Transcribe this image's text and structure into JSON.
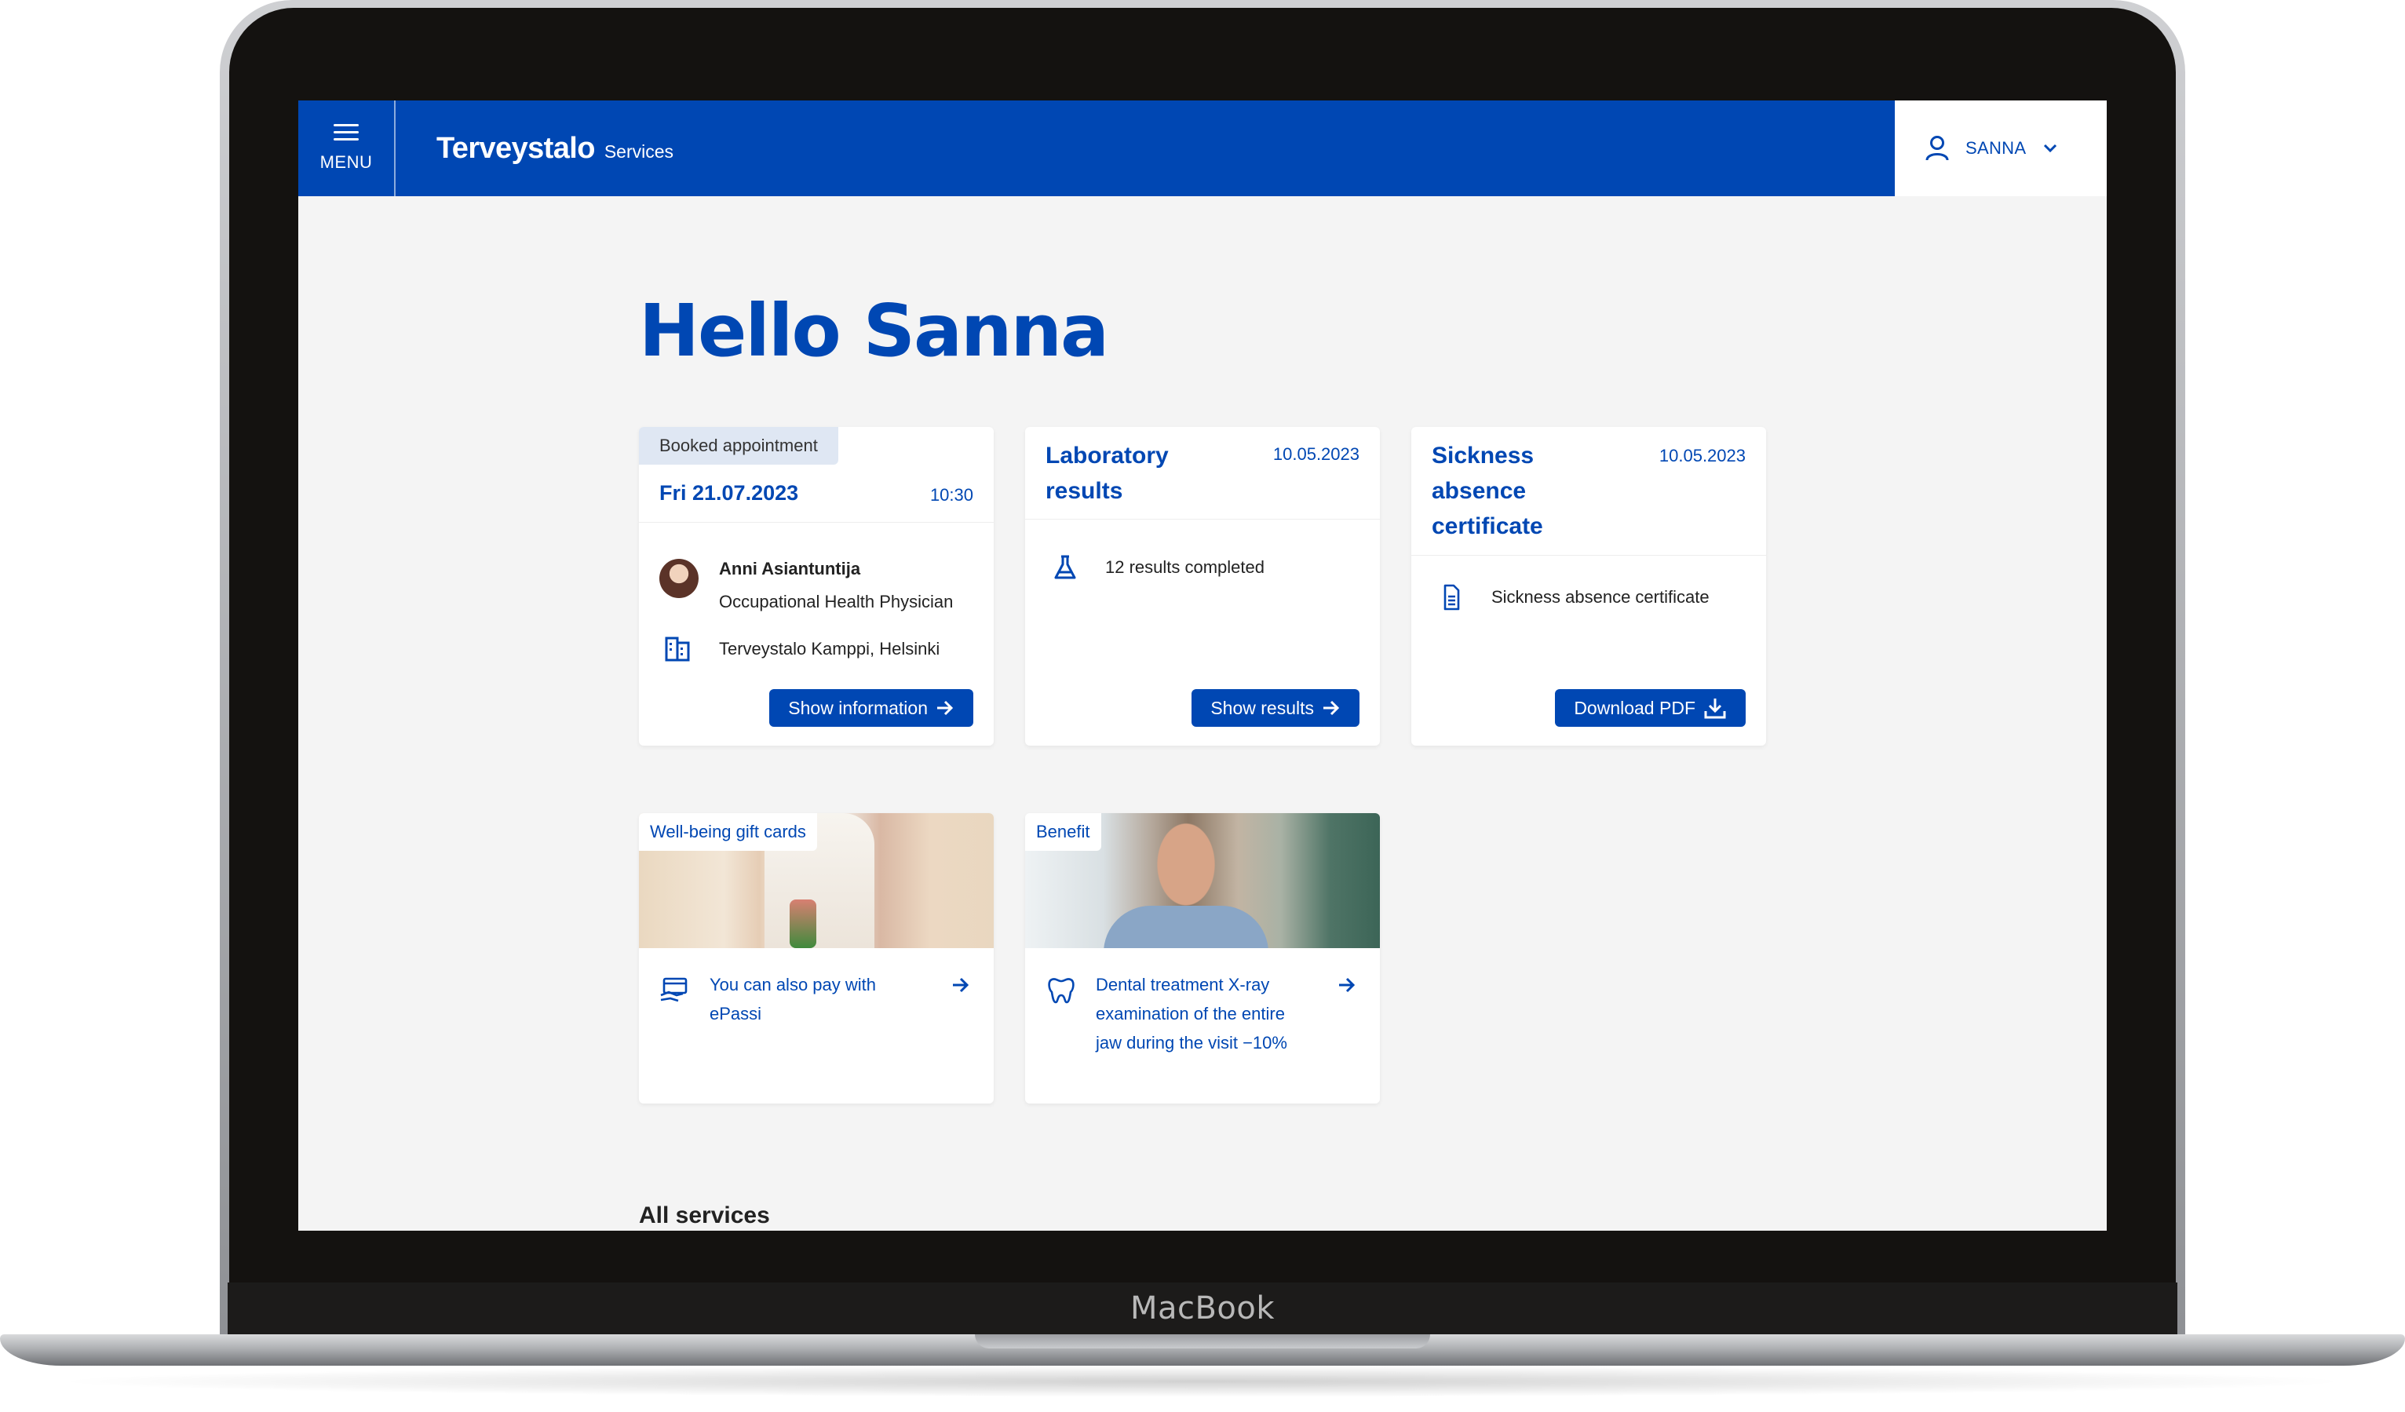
{
  "device": {
    "brand": "MacBook"
  },
  "header": {
    "menu_label": "MENU",
    "logo": "Terveystalo",
    "logo_sub": "Services",
    "user_name": "SANNA"
  },
  "greeting": "Hello Sanna",
  "appointment_card": {
    "tag": "Booked appointment",
    "date": "Fri 21.07.2023",
    "time": "10:30",
    "doctor_name": "Anni Asiantuntija",
    "doctor_role": "Occupational Health Physician",
    "location": "Terveystalo Kamppi, Helsinki",
    "button": "Show information"
  },
  "lab_card": {
    "title_line1": "Laboratory",
    "title_line2": "results",
    "date": "10.05.2023",
    "summary": "12 results completed",
    "button": "Show results"
  },
  "sickness_card": {
    "title_line1": "Sickness",
    "title_line2": "absence",
    "title_line3": "certificate",
    "date": "10.05.2023",
    "document": "Sickness absence certificate",
    "button": "Download PDF"
  },
  "gift_card": {
    "tag": "Well-being gift cards",
    "text": "You can also pay with ePassi"
  },
  "benefit_card": {
    "tag": "Benefit",
    "text": "Dental treatment X-ray examination of the entire jaw during the visit −10%"
  },
  "section_title": "All services",
  "colors": {
    "brand_blue": "#0047b3",
    "background": "#f4f4f4",
    "tag_bg": "#dfe7f3"
  },
  "icons": [
    "menu-icon",
    "user-icon",
    "chevron-down-icon",
    "avatar",
    "building-icon",
    "flask-icon",
    "document-icon",
    "arrow-right-icon",
    "download-icon",
    "card-payment-icon",
    "tooth-icon"
  ]
}
